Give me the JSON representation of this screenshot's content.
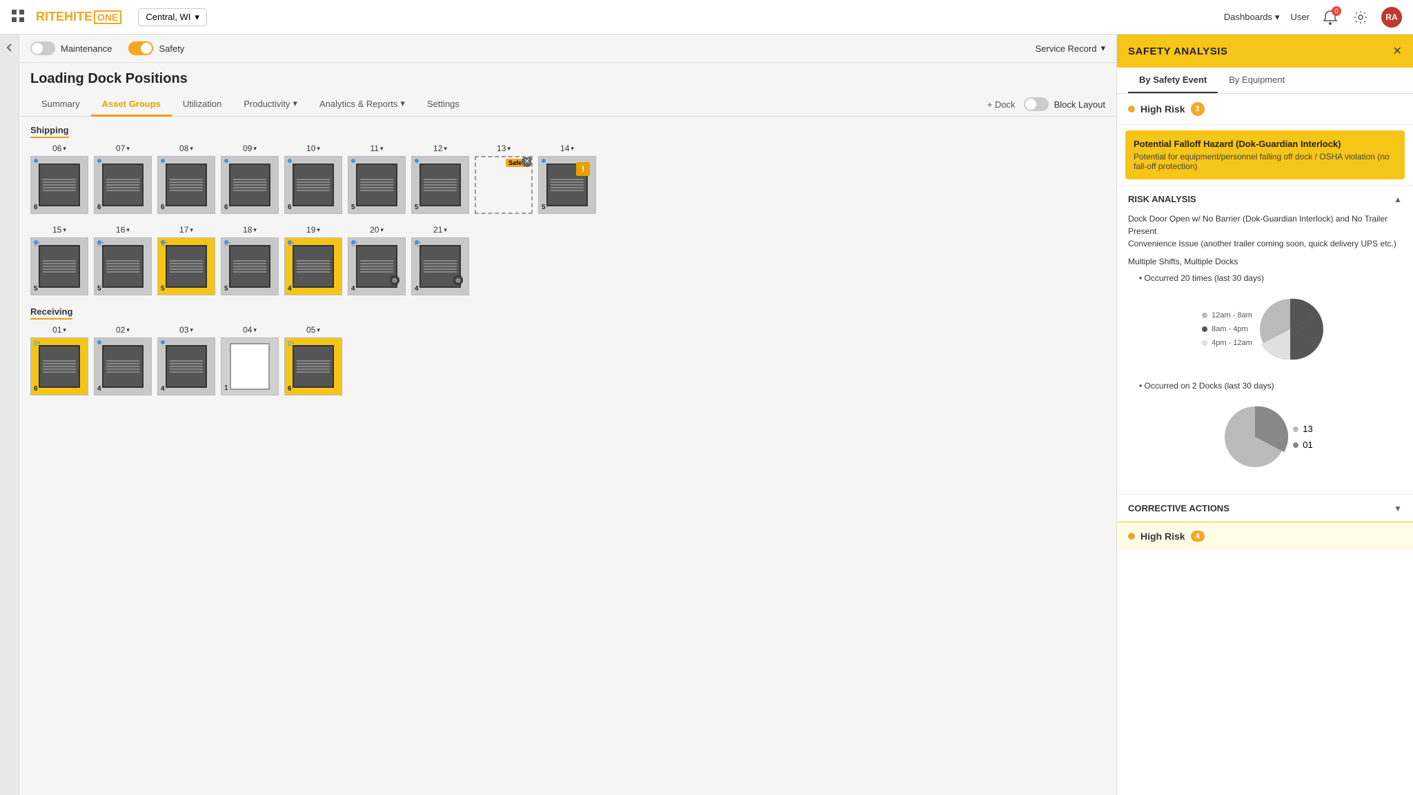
{
  "app": {
    "logo_text_1": "RITEHITE",
    "logo_text_2": "ONE",
    "location": "Central, WI"
  },
  "top_nav": {
    "dashboards_label": "Dashboards",
    "user_label": "User",
    "notification_count": "0",
    "avatar_initials": "RA"
  },
  "controls_bar": {
    "maintenance_label": "Maintenance",
    "safety_label": "Safety",
    "service_record_label": "Service Record"
  },
  "page": {
    "title": "Loading Dock Positions"
  },
  "tabs": [
    {
      "id": "summary",
      "label": "Summary",
      "active": false,
      "has_dropdown": false
    },
    {
      "id": "asset-groups",
      "label": "Asset Groups",
      "active": true,
      "has_dropdown": false
    },
    {
      "id": "utilization",
      "label": "Utilization",
      "active": false,
      "has_dropdown": false
    },
    {
      "id": "productivity",
      "label": "Productivity",
      "active": false,
      "has_dropdown": true
    },
    {
      "id": "analytics",
      "label": "Analytics & Reports",
      "active": false,
      "has_dropdown": true
    },
    {
      "id": "settings",
      "label": "Settings",
      "active": false,
      "has_dropdown": false
    }
  ],
  "toolbar": {
    "add_dock_label": "+ Dock",
    "block_layout_label": "Block Layout"
  },
  "shipping": {
    "label": "Shipping",
    "docks": [
      {
        "num": "06",
        "style": "normal",
        "count": 6,
        "has_dot": true,
        "has_wifi": false
      },
      {
        "num": "07",
        "style": "normal",
        "count": 6,
        "has_dot": true,
        "has_wifi": false
      },
      {
        "num": "08",
        "style": "normal",
        "count": 6,
        "has_dot": true,
        "has_wifi": false
      },
      {
        "num": "09",
        "style": "normal",
        "count": 6,
        "has_dot": true,
        "has_wifi": false
      },
      {
        "num": "10",
        "style": "normal",
        "count": 6,
        "has_dot": true,
        "has_wifi": false
      },
      {
        "num": "11",
        "style": "normal",
        "count": 5,
        "has_dot": true,
        "has_wifi": false
      },
      {
        "num": "12",
        "style": "normal",
        "count": 5,
        "has_dot": true,
        "has_wifi": false
      },
      {
        "num": "13",
        "style": "dashed",
        "count": 0,
        "has_dot": false,
        "has_wifi": false,
        "has_safety_badge": true
      },
      {
        "num": "14",
        "style": "normal_warn",
        "count": 5,
        "has_dot": true,
        "has_wifi": false
      },
      {
        "num": "15",
        "style": "normal",
        "count": 5,
        "has_dot": true,
        "has_wifi": true
      },
      {
        "num": "16",
        "style": "normal",
        "count": 5,
        "has_dot": true,
        "has_wifi": true
      },
      {
        "num": "17",
        "style": "yellow",
        "count": 5,
        "has_dot": true,
        "has_wifi": true
      },
      {
        "num": "18",
        "style": "normal",
        "count": 5,
        "has_dot": true,
        "has_wifi": true
      },
      {
        "num": "19",
        "style": "yellow",
        "count": 4,
        "has_dot": true,
        "has_wifi": true
      },
      {
        "num": "20",
        "style": "normal_gear",
        "count": 4,
        "has_dot": true,
        "has_wifi": true
      },
      {
        "num": "21",
        "style": "normal_gear",
        "count": 4,
        "has_dot": true,
        "has_wifi": true
      }
    ]
  },
  "receiving": {
    "label": "Receiving",
    "docks": [
      {
        "num": "01",
        "style": "yellow",
        "count": 6,
        "has_dot": false,
        "has_wifi": true
      },
      {
        "num": "02",
        "style": "normal",
        "count": 4,
        "has_dot": true,
        "has_wifi": false
      },
      {
        "num": "03",
        "style": "normal",
        "count": 4,
        "has_dot": true,
        "has_wifi": false
      },
      {
        "num": "04",
        "style": "gray_open",
        "count": 1,
        "has_dot": false,
        "has_wifi": false
      },
      {
        "num": "05",
        "style": "yellow",
        "count": 6,
        "has_dot": false,
        "has_wifi": true
      }
    ]
  },
  "safety_panel": {
    "title": "SAFETY ANALYSIS",
    "tabs": [
      {
        "id": "by-safety-event",
        "label": "By Safety Event",
        "active": true
      },
      {
        "id": "by-equipment",
        "label": "By Equipment",
        "active": false
      }
    ],
    "high_risk": {
      "label": "High Risk",
      "count": 2
    },
    "alert": {
      "title": "Potential Falloff Hazard (Dok-Guardian Interlock)",
      "description": "Potential for equipment/personnel falling off dock / OSHA violation (no fall-off protection)"
    },
    "risk_analysis": {
      "title": "RISK ANALYSIS",
      "main_text": "Dock Door Open w/ No Barrier (Dok-Guardian Interlock) and No Trailer Present",
      "sub_text": "Convenience Issue (another trailer coming soon, quick delivery UPS etc.)",
      "shift_label": "Multiple Shifts, Multiple Docks",
      "occurrence_1": "Occurred 20 times (last 30 days)",
      "occurrence_2": "Occurred on 2 Docks (last 30 days)",
      "pie1": {
        "labels": [
          "12am - 8am",
          "8am - 4pm",
          "4pm - 12am"
        ],
        "values": [
          35,
          45,
          20
        ],
        "colors": [
          "#bbb",
          "#888",
          "#ddd"
        ]
      },
      "pie2": {
        "labels": [
          "13",
          "01"
        ],
        "values": [
          60,
          40
        ],
        "colors": [
          "#bbb",
          "#888"
        ]
      }
    },
    "corrective_actions": {
      "title": "CORRECTIVE ACTIONS"
    },
    "footer": {
      "risk_label": "High Risk",
      "risk_count": 4
    }
  }
}
